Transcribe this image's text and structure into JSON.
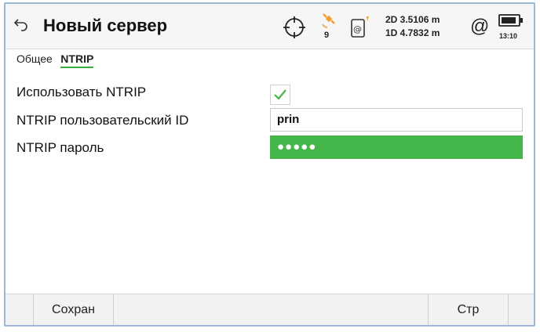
{
  "header": {
    "back_icon": "back-arrow-icon",
    "title": "Новый сервер",
    "satellites": "9",
    "precision_2d": "2D 3.5106 m",
    "precision_1d": "1D 4.7832 m",
    "at_symbol": "@",
    "time": "13:10"
  },
  "tabs": [
    {
      "label": "Общее",
      "active": false
    },
    {
      "label": "NTRIP",
      "active": true
    }
  ],
  "form": {
    "use_ntrip_label": "Использовать  NTRIP",
    "use_ntrip_checked": true,
    "user_id_label": "NTRIP пользовательский  ID",
    "user_id_value": "prin",
    "password_label": "NTRIP пароль",
    "password_value": "●●●●●"
  },
  "softkeys": {
    "save": "Сохран",
    "page": "Стр"
  },
  "colors": {
    "accent_green": "#45b649",
    "frame_border": "#9db8d6",
    "sat_icon": "#f0a030"
  }
}
